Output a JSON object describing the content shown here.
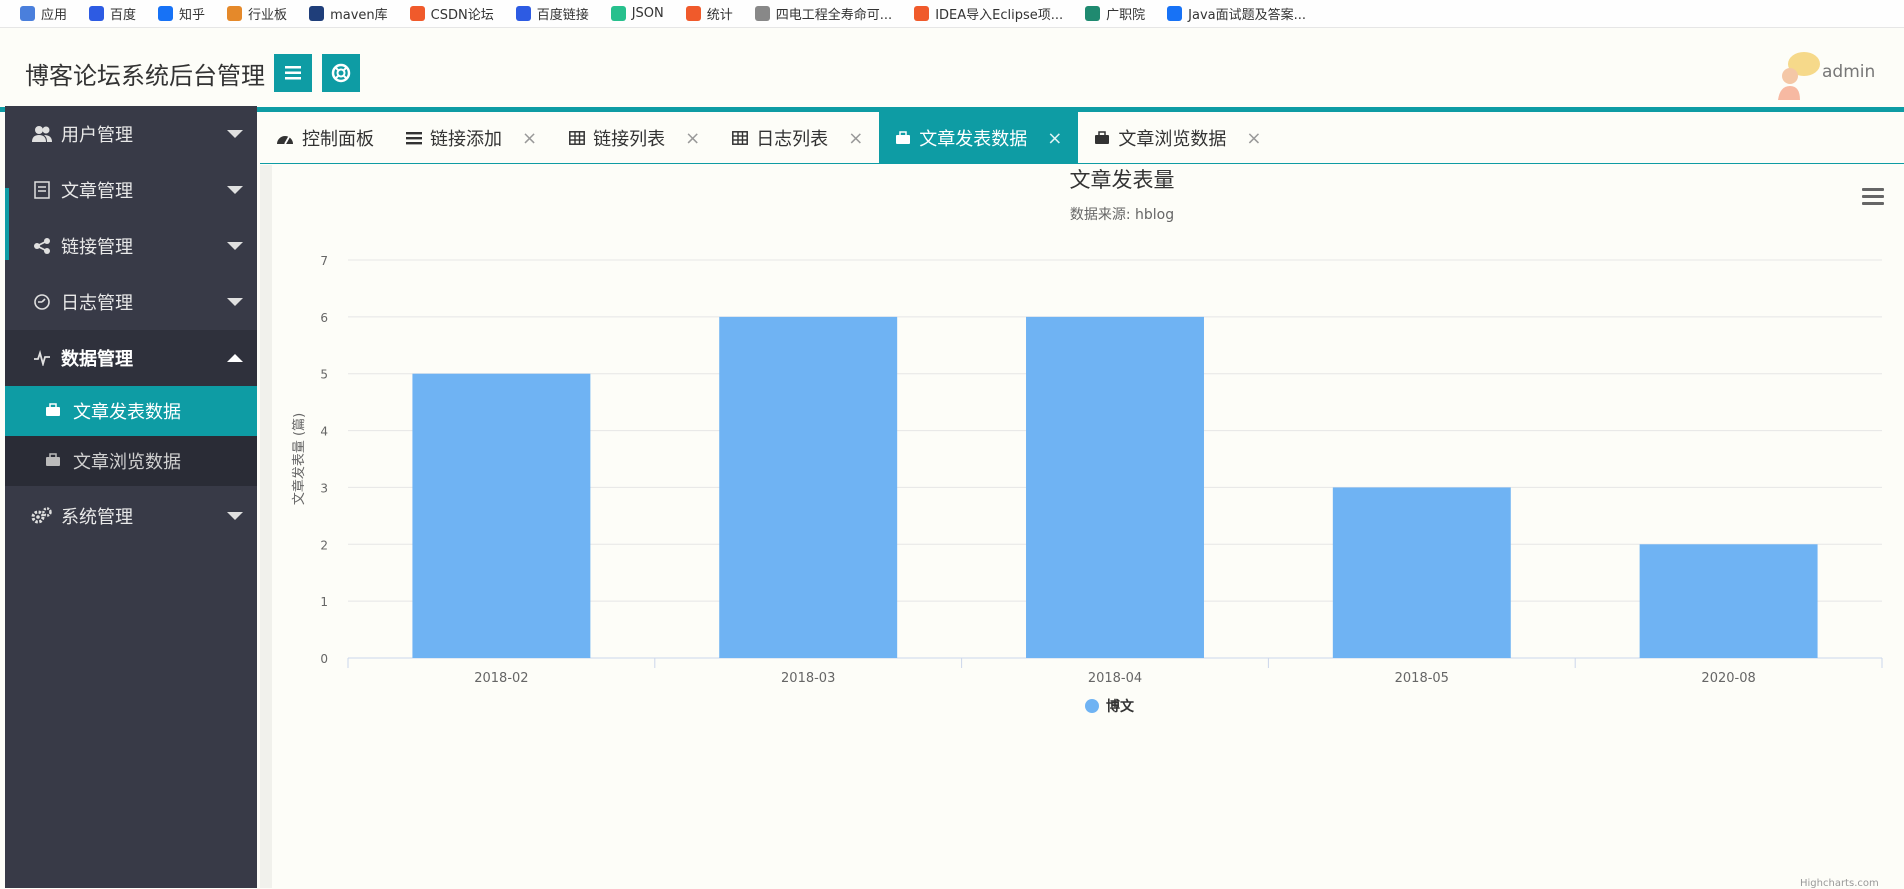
{
  "bookmarks": [
    {
      "label": "应用",
      "icon": "apps-grid-icon",
      "color": "#4a7fdc"
    },
    {
      "label": "百度",
      "icon": "baidu-icon",
      "color": "#2d5be3"
    },
    {
      "label": "知乎",
      "icon": "zhihu-icon",
      "color": "#1772f6"
    },
    {
      "label": "行业板",
      "icon": "feather-icon",
      "color": "#e5892a"
    },
    {
      "label": "maven库",
      "icon": "mvn-icon",
      "color": "#1f3e7a"
    },
    {
      "label": "CSDN论坛",
      "icon": "csdn-icon",
      "color": "#f05a2b"
    },
    {
      "label": "百度链接",
      "icon": "baidu-icon",
      "color": "#2d5be3"
    },
    {
      "label": "JSON",
      "icon": "json-icon",
      "color": "#27c08d"
    },
    {
      "label": "统计",
      "icon": "csdn-icon",
      "color": "#f05a2b"
    },
    {
      "label": "四电工程全寿命可...",
      "icon": "tower-icon",
      "color": "#888888"
    },
    {
      "label": "IDEA导入Eclipse项...",
      "icon": "csdn-icon",
      "color": "#f05a2b"
    },
    {
      "label": "广职院",
      "icon": "vue-icon",
      "color": "#1f8a70"
    },
    {
      "label": "Java面试题及答案...",
      "icon": "zhihu-icon",
      "color": "#1772f6"
    }
  ],
  "header": {
    "title": "博客论坛系统后台管理",
    "user": "admin",
    "accent": "#0e9ca4"
  },
  "sidebar": {
    "items": [
      {
        "label": "用户管理",
        "icon": "users-icon",
        "expanded": false
      },
      {
        "label": "文章管理",
        "icon": "document-icon",
        "expanded": false
      },
      {
        "label": "链接管理",
        "icon": "share-icon",
        "expanded": false
      },
      {
        "label": "日志管理",
        "icon": "log-icon",
        "expanded": false
      },
      {
        "label": "数据管理",
        "icon": "pulse-icon",
        "expanded": true
      },
      {
        "label": "系统管理",
        "icon": "cogs-icon",
        "expanded": false
      }
    ],
    "sub_items": [
      {
        "label": "文章发表数据",
        "icon": "briefcase-icon",
        "active": true
      },
      {
        "label": "文章浏览数据",
        "icon": "briefcase-icon",
        "active": false
      }
    ]
  },
  "tabs": [
    {
      "label": "控制面板",
      "icon": "dashboard-icon",
      "closable": false,
      "active": false
    },
    {
      "label": "链接添加",
      "icon": "list-icon",
      "closable": true,
      "active": false
    },
    {
      "label": "链接列表",
      "icon": "table-icon",
      "closable": true,
      "active": false
    },
    {
      "label": "日志列表",
      "icon": "table-icon",
      "closable": true,
      "active": false
    },
    {
      "label": "文章发表数据",
      "icon": "briefcase-icon",
      "closable": true,
      "active": true
    },
    {
      "label": "文章浏览数据",
      "icon": "briefcase-icon",
      "closable": true,
      "active": false
    }
  ],
  "close_glyph": "×",
  "chart_data": {
    "type": "bar",
    "title": "文章发表量",
    "subtitle": "数据来源: hblog",
    "ylabel": "文章发表量 (篇)",
    "xlabel": "",
    "categories": [
      "2018-02",
      "2018-03",
      "2018-04",
      "2018-05",
      "2020-08"
    ],
    "series": [
      {
        "name": "博文",
        "values": [
          5,
          6,
          6,
          3,
          2
        ],
        "color": "#6fb3f3"
      }
    ],
    "ylim": [
      0,
      7
    ],
    "yticks": [
      0,
      1,
      2,
      3,
      4,
      5,
      6,
      7
    ],
    "grid": true,
    "legend": "bottom-center",
    "credits": "Highcharts.com"
  }
}
